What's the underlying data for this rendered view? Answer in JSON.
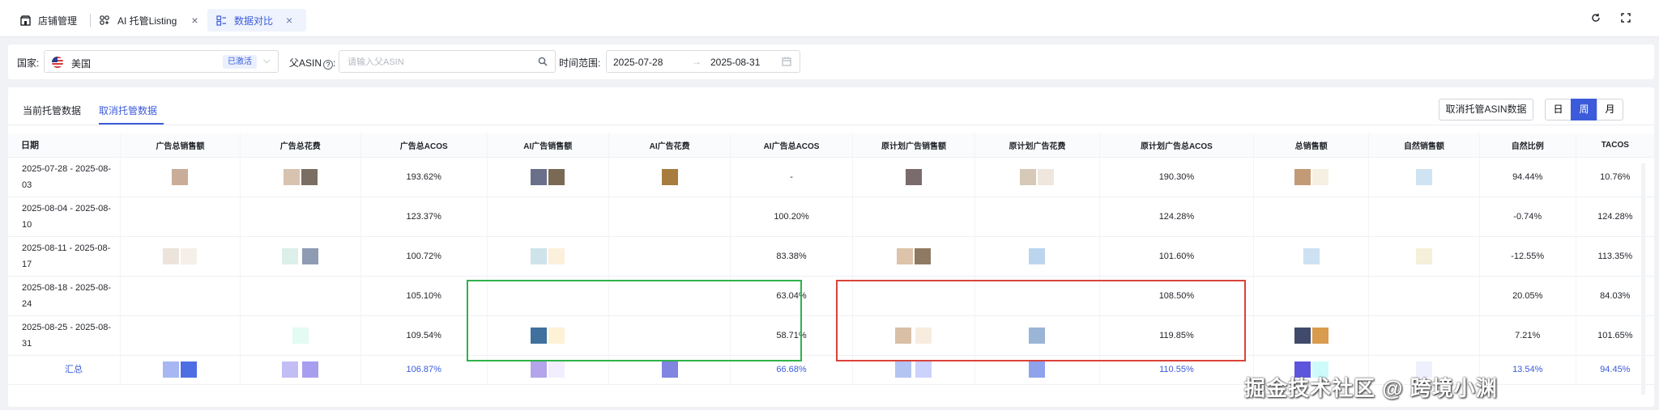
{
  "tabs": [
    {
      "label": "店铺管理",
      "icon": "store-icon"
    },
    {
      "label": "AI 托管Listing",
      "icon": "ai-listing-icon",
      "close": "×"
    },
    {
      "label": "数据对比",
      "icon": "compare-icon",
      "close": "×",
      "active": true
    }
  ],
  "toolbar_icons": [
    "refresh-icon",
    "fullscreen-icon"
  ],
  "filters": {
    "country_label": "国家:",
    "country_value": "美国",
    "country_badge": "已激活",
    "asin_label": "父ASIN",
    "asin_placeholder": "请输入父ASIN",
    "date_label": "时间范围:",
    "date_start": "2025-07-28",
    "date_arrow": "→",
    "date_end": "2025-08-31"
  },
  "subtabs": [
    "当前托管数据",
    "取消托管数据"
  ],
  "active_subtab": 1,
  "cancel_button": "取消托管ASIN数据",
  "periods": [
    "日",
    "周",
    "月"
  ],
  "active_period": "周",
  "columns": [
    "日期",
    "广告总销售额",
    "广告总花费",
    "广告总ACOS",
    "AI广告销售额",
    "AI广告花费",
    "AI广告总ACOS",
    "原计划广告销售额",
    "原计划广告花费",
    "原计划广告总ACOS",
    "总销售额",
    "自然销售额",
    "自然比例",
    "TACOS"
  ],
  "rows": [
    {
      "date_line1": "2025-07-28 - 2025-08-",
      "date_line2": "03",
      "ad_acos": "193.62%",
      "ai_acos": "-",
      "orig_acos": "190.30%",
      "natural_ratio": "94.44%",
      "tacos": "10.76%"
    },
    {
      "date_line1": "2025-08-04 - 2025-08-",
      "date_line2": "10",
      "ad_acos": "123.37%",
      "ai_acos": "100.20%",
      "orig_acos": "124.28%",
      "natural_ratio": "-0.74%",
      "tacos": "124.28%"
    },
    {
      "date_line1": "2025-08-11 - 2025-08-",
      "date_line2": "17",
      "ad_acos": "100.72%",
      "ai_acos": "83.38%",
      "orig_acos": "101.60%",
      "natural_ratio": "-12.55%",
      "tacos": "113.35%"
    },
    {
      "date_line1": "2025-08-18 - 2025-08-",
      "date_line2": "24",
      "ad_acos": "105.10%",
      "ai_acos": "63.04%",
      "orig_acos": "108.50%",
      "natural_ratio": "20.05%",
      "tacos": "84.03%"
    },
    {
      "date_line1": "2025-08-25 - 2025-08-",
      "date_line2": "31",
      "ad_acos": "109.54%",
      "ai_acos": "58.71%",
      "orig_acos": "119.85%",
      "natural_ratio": "7.21%",
      "tacos": "101.65%"
    }
  ],
  "total_row": {
    "label": "汇总",
    "ad_acos": "106.87%",
    "ai_acos": "66.68%",
    "orig_acos": "110.55%",
    "natural_ratio": "13.54%",
    "tacos": "94.45%"
  },
  "highlight_colors": {
    "ai": "#2fb24a",
    "original": "#d9433a"
  },
  "accent_color": "#3b5bdb",
  "watermark": "掘金技术社区 @ 跨境小渊"
}
